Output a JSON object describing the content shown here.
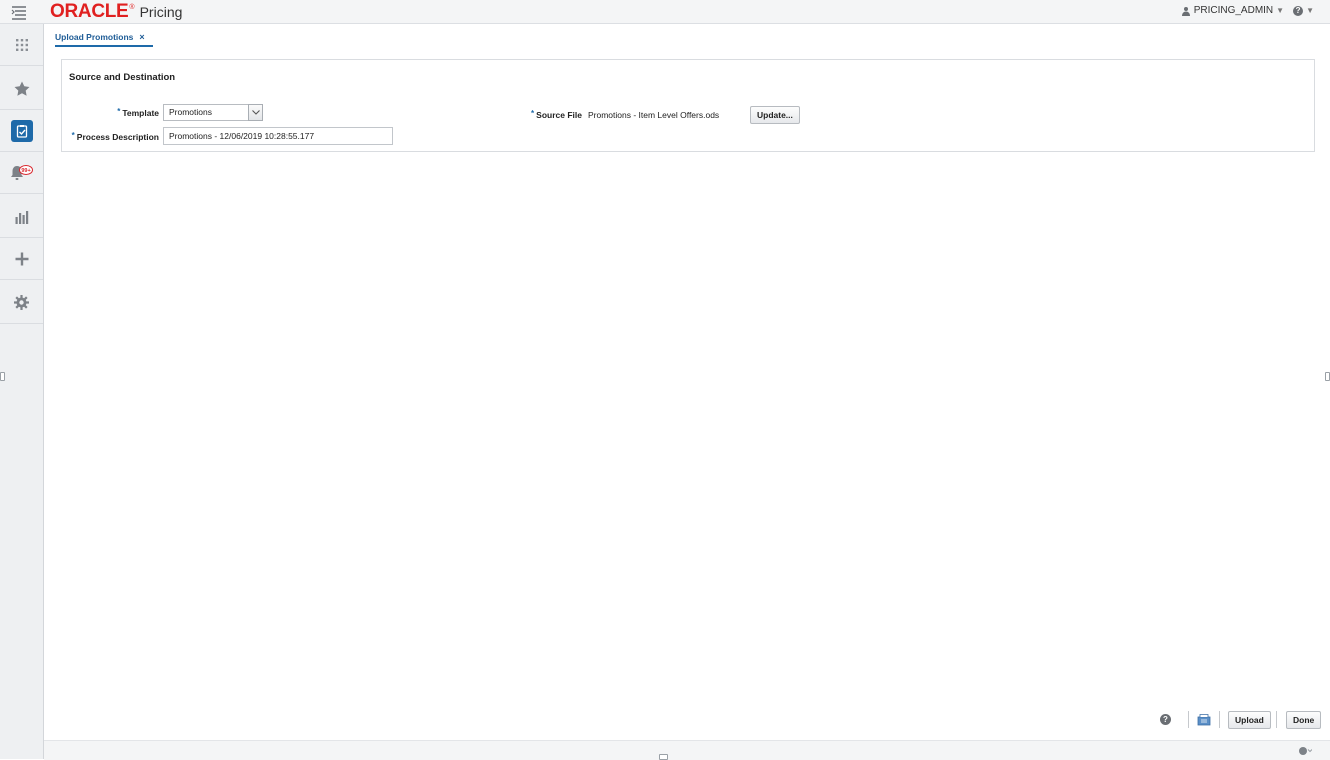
{
  "header": {
    "logo_text": "ORACLE",
    "logo_mark": "®",
    "product": "Pricing",
    "user": "PRICING_ADMIN",
    "icons": [
      "task-menu-icon",
      "user-icon",
      "chevron-down-icon",
      "help-icon"
    ]
  },
  "rail": {
    "items": [
      "apps-icon",
      "favorites-star-icon",
      "tasks-icon",
      "notifications-bell-icon",
      "reports-icon",
      "add-icon",
      "settings-gear-icon"
    ],
    "notification_badge": "99+"
  },
  "tabs": [
    {
      "label": "Upload Promotions",
      "close": "×",
      "active": true
    }
  ],
  "section": {
    "title": "Source and Destination",
    "required_marker": "*",
    "template": {
      "label": "Template",
      "value": "Promotions"
    },
    "process_description": {
      "label": "Process Description",
      "value": "Promotions - 12/06/2019 10:28:55.177"
    },
    "source_file": {
      "label": "Source File",
      "value": "Promotions - Item Level Offers.ods",
      "button": "Update..."
    }
  },
  "actions": {
    "upload": "Upload",
    "done": "Done",
    "icons": [
      "help-icon",
      "export-icon"
    ]
  },
  "colors": {
    "accent": "#1e6aa9",
    "brand_red": "#e02020",
    "header_bg": "#f4f5f6",
    "rail_bg": "#eef0f2"
  }
}
